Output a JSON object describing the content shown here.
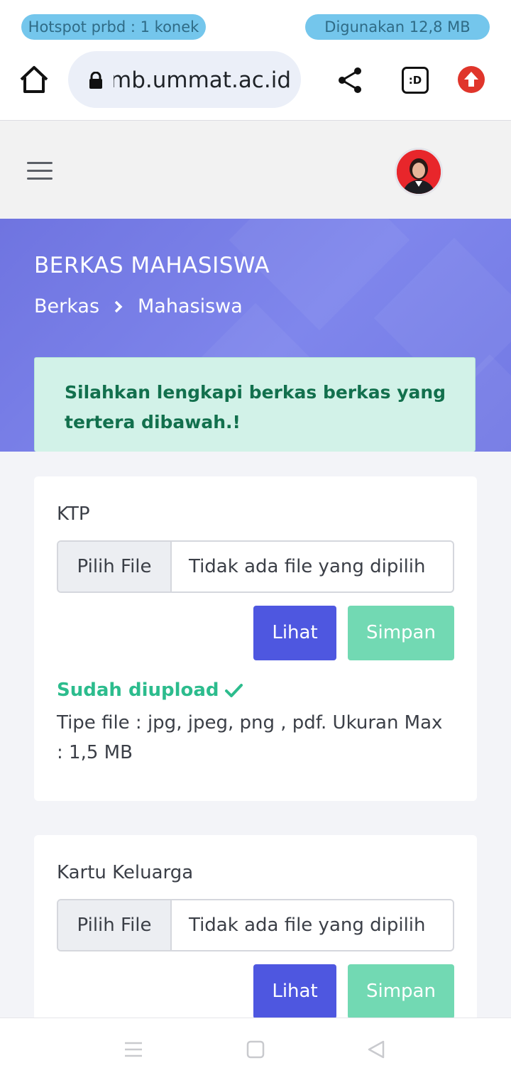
{
  "status": {
    "hotspot": "Hotspot prbd : 1 konek",
    "usage": "Digunakan 12,8 MB"
  },
  "browser": {
    "url": "pmb.ummat.ac.id",
    "tab_badge": ":D"
  },
  "hero": {
    "title": "BERKAS MAHASISWA",
    "breadcrumb": [
      "Berkas",
      "Mahasiswa"
    ],
    "alert": "Silahkan lengkapi berkas berkas yang tertera dibawah.!"
  },
  "documents": [
    {
      "title": "KTP",
      "choose_label": "Pilih File",
      "file_name": "Tidak ada file yang dipilih",
      "view_label": "Lihat",
      "save_label": "Simpan",
      "status": "Sudah diupload",
      "file_info": "Tipe file : jpg, jpeg, png , pdf. Ukuran Max : 1,5 MB"
    },
    {
      "title": "Kartu Keluarga",
      "choose_label": "Pilih File",
      "file_name": "Tidak ada file yang dipilih",
      "view_label": "Lihat",
      "save_label": "Simpan"
    }
  ],
  "colors": {
    "hero": "#7279e4",
    "primary": "#4e57e0",
    "success": "#2cbc8d",
    "alert_bg": "#d2f2e8"
  }
}
